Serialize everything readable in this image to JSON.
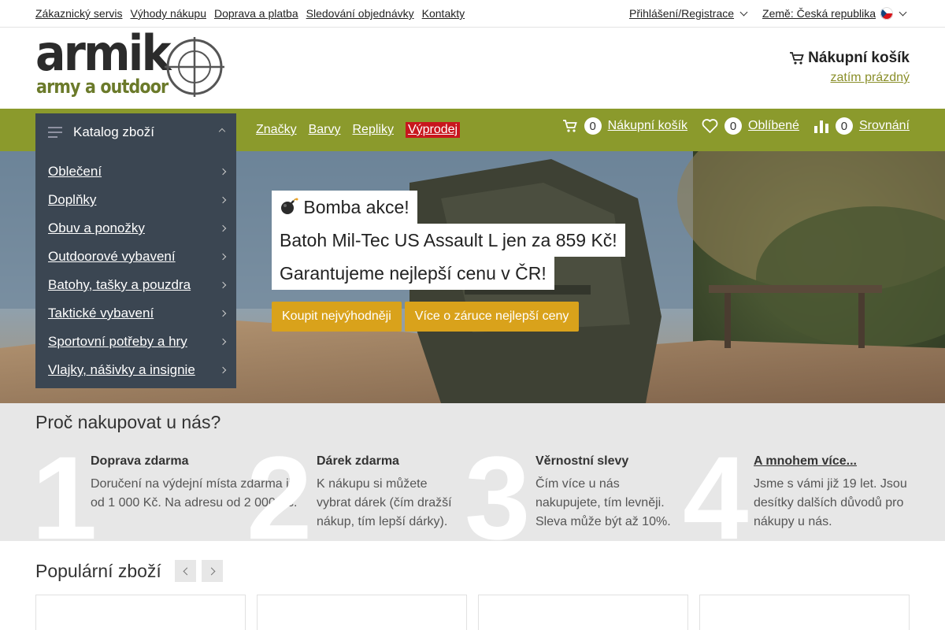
{
  "topbar": {
    "links": [
      "Zákaznický servis",
      "Výhody nákupu",
      "Doprava a platba",
      "Sledování objednávky",
      "Kontakty"
    ],
    "login": "Přihlášení/Registrace",
    "country": "Země: Česká republika"
  },
  "logo": {
    "word": "armik",
    "tagline": "army a outdoor"
  },
  "cart": {
    "title": "Nákupní košík",
    "status": "zatím prázdný"
  },
  "nav": {
    "catalog_label": "Katalog zboží",
    "links": [
      "Značky",
      "Barvy",
      "Repliky",
      "Výprodej"
    ],
    "cart": {
      "count": "0",
      "label": "Nákupní košík"
    },
    "favorites": {
      "count": "0",
      "label": "Oblíbené"
    },
    "compare": {
      "count": "0",
      "label": "Srovnání"
    }
  },
  "menu": {
    "items": [
      "Oblečení",
      "Doplňky",
      "Obuv a ponožky",
      "Outdoorové vybavení",
      "Batohy, tašky a pouzdra",
      "Taktické vybavení",
      "Sportovní potřeby a hry",
      "Vlajky, nášivky a insignie"
    ]
  },
  "promo": {
    "line1": "Bomba akce!",
    "line2": "Batoh Mil-Tec US Assault L jen za 859 Kč!",
    "line3": "Garantujeme nejlepší cenu v ČR!",
    "button1": "Koupit nejvýhodněji",
    "button2": "Více o záruce nejlepší ceny"
  },
  "why": {
    "title": "Proč nakupovat u nás?",
    "features": [
      {
        "num": "1",
        "title": "Doprava zdarma",
        "text": "Doručení na výdejní místa zdarma již od 1 000 Kč. Na adresu od 2 000 Kč."
      },
      {
        "num": "2",
        "title": "Dárek zdarma",
        "text": "K nákupu si můžete vybrat dárek (čím dražší nákup, tím lepší dárky)."
      },
      {
        "num": "3",
        "title": "Věrnostní slevy",
        "text": "Čím více u nás nakupujete, tím levněji. Sleva může být až 10%."
      },
      {
        "num": "4",
        "title": "A mnohem více...",
        "text": "Jsme s vámi již 19 let. Jsou desítky dalších důvodů pro nákupy u nás."
      }
    ]
  },
  "popular": {
    "title": "Populární zboží"
  },
  "colors": {
    "olive": "#8b9a2c",
    "navy": "#3b4652",
    "sale": "#c8161d",
    "gold": "#d9a21b"
  }
}
